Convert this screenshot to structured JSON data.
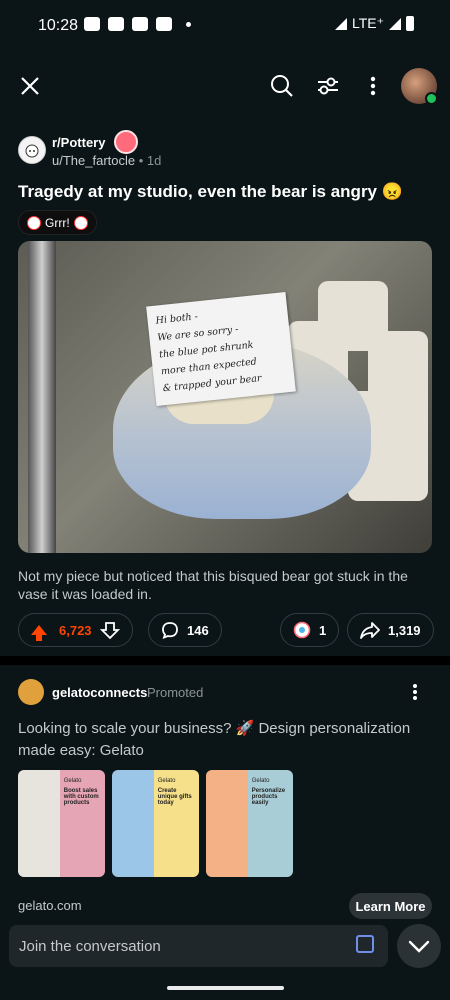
{
  "status": {
    "time": "10:28",
    "network": "LTE⁺"
  },
  "post": {
    "subreddit": "r/Pottery",
    "author": "u/The_fartocle",
    "time_ago": "1d",
    "title": "Tragedy at my studio, even the bear is angry 😠",
    "flair": "Grrr!",
    "note_text": [
      "Hi both -",
      "We are so sorry -",
      "the blue pot shrunk",
      "more than expected",
      "& trapped your bear"
    ],
    "description": "Not my piece but noticed that this bisqued bear got stuck in the vase it was loaded in.",
    "score": "6,723",
    "comments": "146",
    "awards": "1",
    "shares": "1,319"
  },
  "ad": {
    "advertiser": "gelatoconnects",
    "promoted_label": "Promoted",
    "text": "Looking to scale your business? 🚀 Design personalization made easy: Gelato",
    "thumbs": [
      {
        "brand": "Gelato",
        "headline": "Boost sales with custom products"
      },
      {
        "brand": "Gelato",
        "headline": "Create unique gifts today"
      },
      {
        "brand": "Gelato",
        "headline": "Personalize products easily"
      }
    ],
    "domain": "gelato.com",
    "cta": "Learn More"
  },
  "composer": {
    "placeholder": "Join the conversation"
  },
  "colors": {
    "background": "#0b1416",
    "upvote": "#ff4500",
    "ad_cta": "#2d3437"
  }
}
